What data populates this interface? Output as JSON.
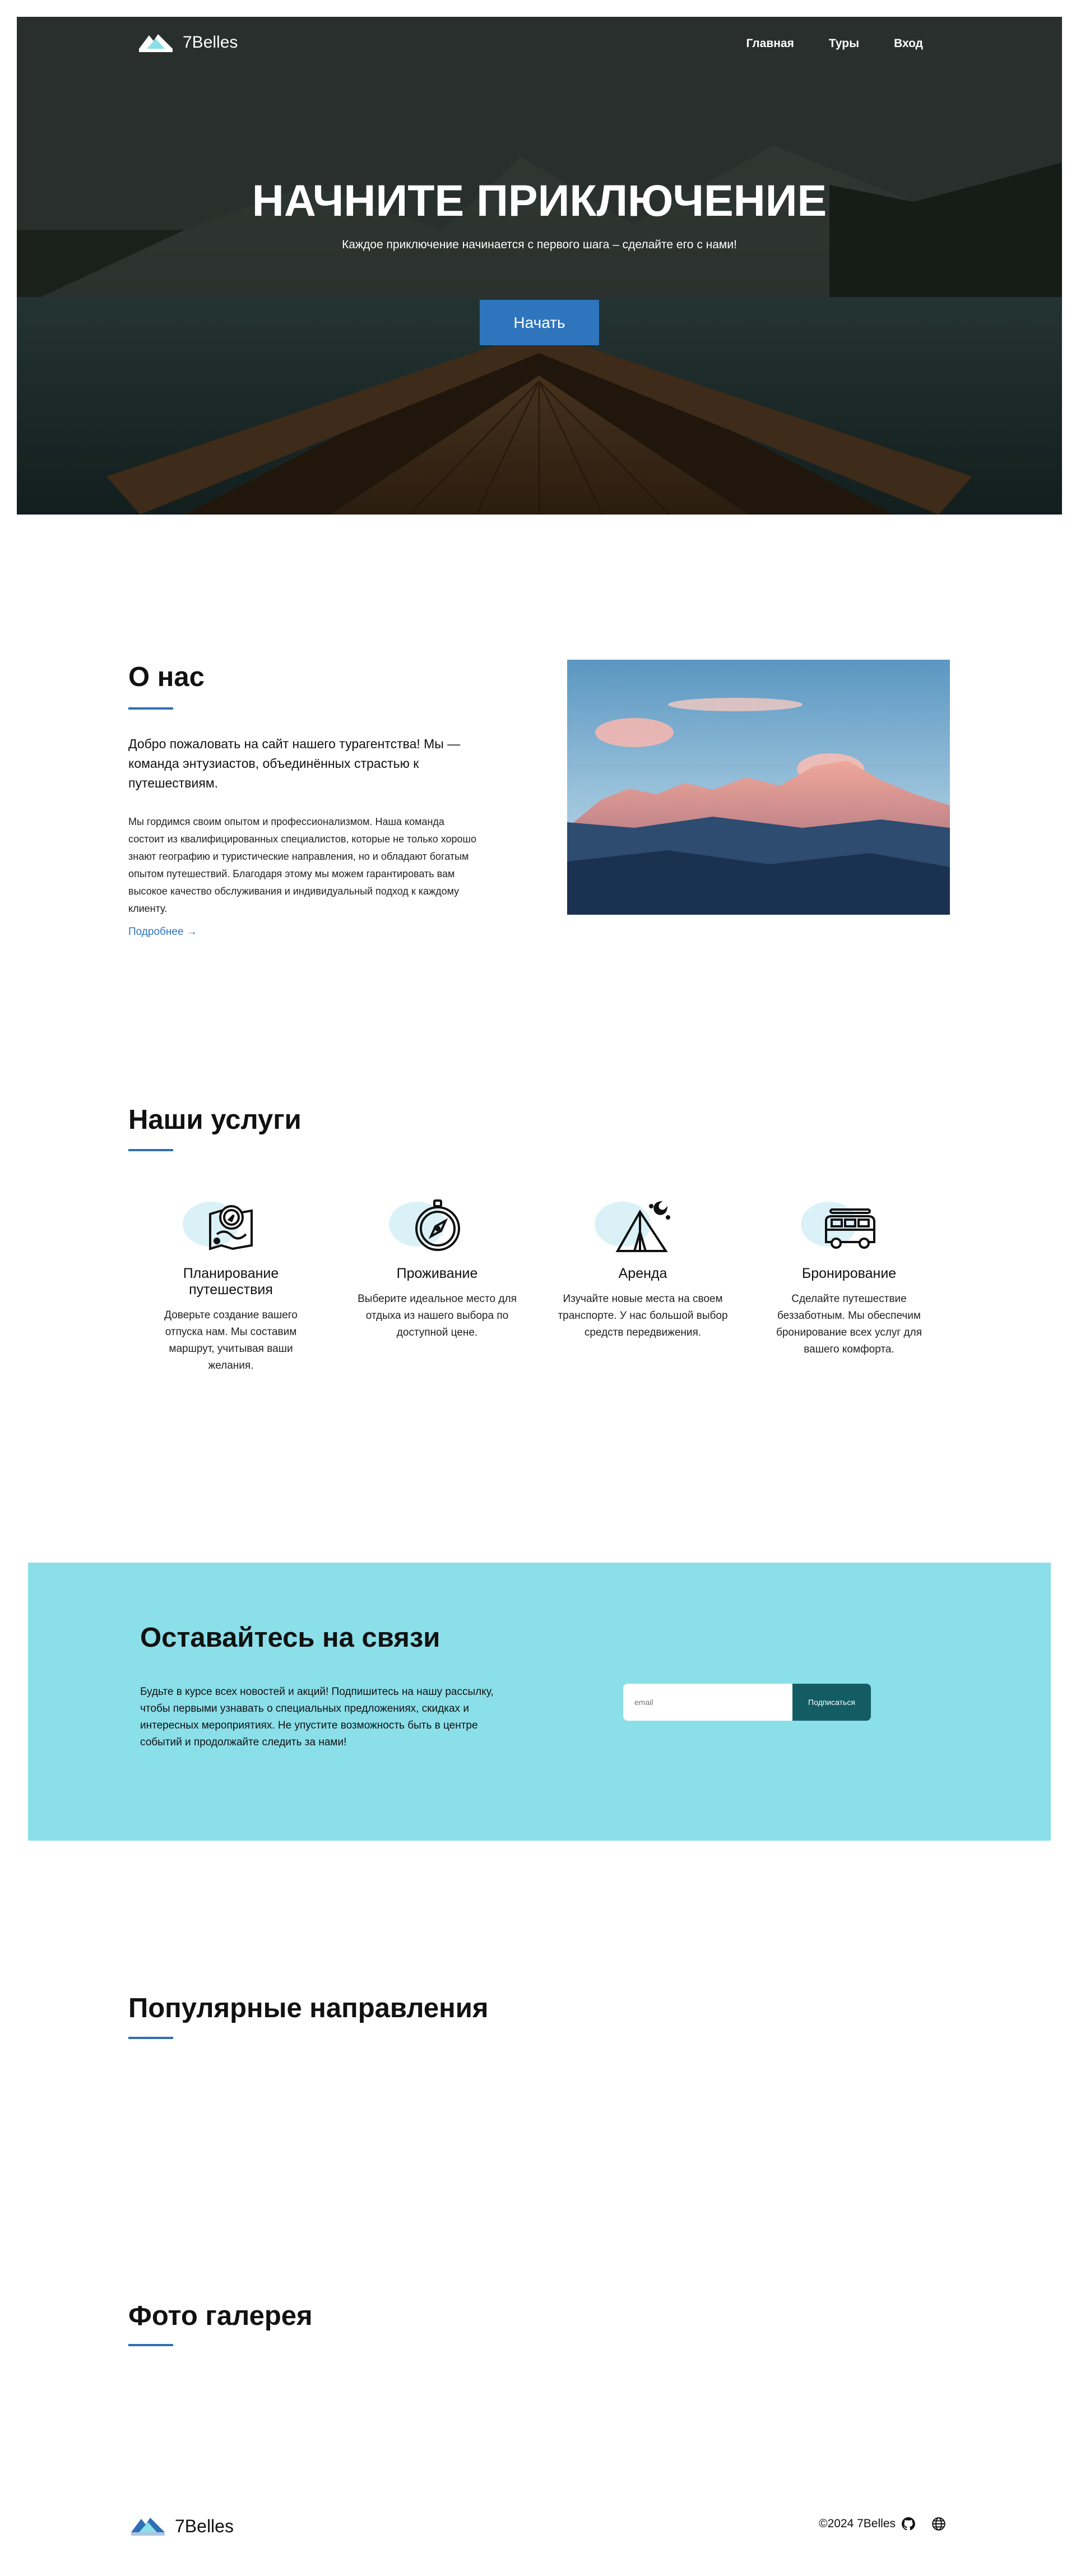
{
  "nav": {
    "brand": "7Belles",
    "links": [
      "Главная",
      "Туры",
      "Вход"
    ]
  },
  "hero": {
    "title": "НАЧНИТЕ ПРИКЛЮЧЕНИЕ",
    "subtitle": "Каждое приключение начинается с первого шага – сделайте его с нами!",
    "cta": "Начать"
  },
  "about": {
    "title": "О нас",
    "lead": "Добро пожаловать на сайт нашего турагентства! Мы — команда энтузиастов, объединённых страстью к путешествиям.",
    "body": "Мы гордимся своим опытом и профессионализмом. Наша команда состоит из квалифицированных специалистов, которые не только хорошо знают географию и туристические направления, но и обладают богатым опытом путешествий. Благодаря этому мы можем гарантировать вам высокое качество обслуживания и индивидуальный подход к каждому клиенту.",
    "more": "Подробнее →"
  },
  "services": {
    "title": "Наши услуги",
    "items": [
      {
        "icon": "map-compass-icon",
        "name": "Планирование путешествия",
        "desc": "Доверьте создание вашего отпуска нам. Мы составим маршрут, учитывая ваши желания."
      },
      {
        "icon": "compass-icon",
        "name": "Проживание",
        "desc": "Выберите идеальное место для отдыха из нашего выбора по доступной цене."
      },
      {
        "icon": "tent-icon",
        "name": "Аренда",
        "desc": "Изучайте новые места на своем транспорте. У нас большой выбор средств передвижения."
      },
      {
        "icon": "van-icon",
        "name": "Бронирование",
        "desc": "Сделайте путешествие беззаботным. Мы обеспечим бронирование всех услуг для вашего комфорта."
      }
    ]
  },
  "newsletter": {
    "title": "Оставайтесь на связи",
    "text": "Будьте в курсе всех новостей и акций! Подпишитесь на нашу рассылку, чтобы первыми узнавать о специальных предложениях, скидках и интересных мероприятиях. Не упустите возможность быть в центре событий и продолжайте следить за нами!",
    "placeholder": "email",
    "button": "Подписаться",
    "bg": "#8adfe9",
    "button_color": "#145c63"
  },
  "destinations": {
    "title": "Популярные направления"
  },
  "gallery": {
    "title": "Фото галерея"
  },
  "footer": {
    "brand": "7Belles",
    "copyright": "©2024 7Belles",
    "icons": [
      "github-icon",
      "globe-icon"
    ]
  },
  "colors": {
    "accent": "#2f75bd",
    "underline": "#2f6fb5"
  }
}
